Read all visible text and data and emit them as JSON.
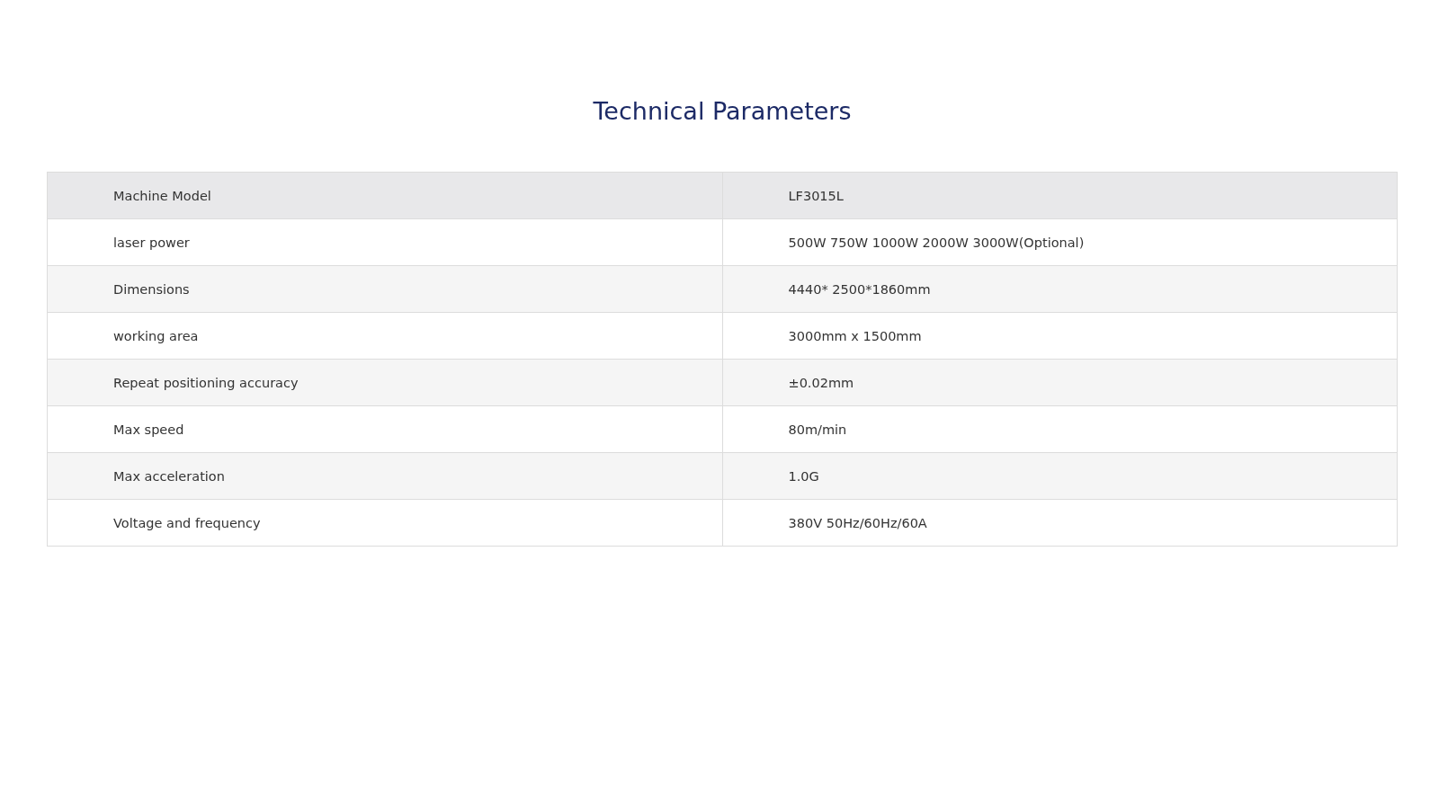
{
  "title": "Technical Parameters",
  "table": {
    "header": [
      "Machine Model",
      "LF3015L"
    ],
    "rows": [
      [
        "laser power",
        "500W 750W 1000W 2000W 3000W(Optional)"
      ],
      [
        "Dimensions",
        "4440* 2500*1860mm"
      ],
      [
        "working area",
        "3000mm x 1500mm"
      ],
      [
        "Repeat positioning accuracy",
        "±0.02mm"
      ],
      [
        "Max speed",
        "80m/min"
      ],
      [
        "Max acceleration",
        "1.0G"
      ],
      [
        "Voltage and frequency",
        "380V 50Hz/60Hz/60A"
      ]
    ]
  }
}
